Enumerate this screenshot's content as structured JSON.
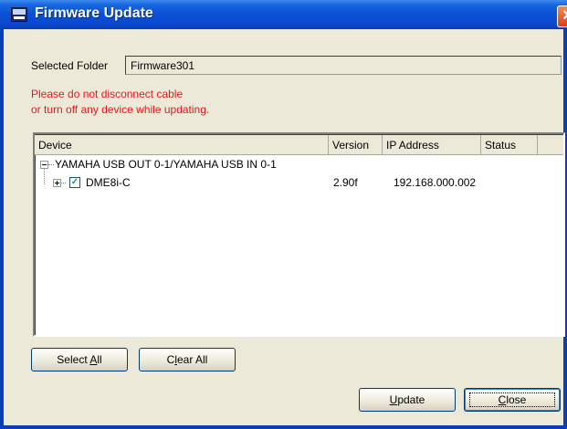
{
  "window": {
    "title": "Firmware Update",
    "close_glyph": "✕",
    "icon": "dme-app-icon"
  },
  "folder": {
    "label": "Selected Folder",
    "value": "Firmware301"
  },
  "warning": {
    "line1": "Please do not disconnect cable",
    "line2": "or turn off any device while updating."
  },
  "table": {
    "columns": [
      "Device",
      "Version",
      "IP Address",
      "Status"
    ],
    "root": {
      "label": "YAMAHA USB OUT 0-1/YAMAHA USB IN 0-1",
      "expanded": true
    },
    "devices": [
      {
        "name": "DME8i-C",
        "version": "2.90f",
        "ip": "192.168.000.002",
        "status": "",
        "checked": true
      }
    ]
  },
  "buttons": {
    "select_all": {
      "pre": "Select ",
      "mnemonic": "A",
      "post": "ll"
    },
    "clear_all": {
      "pre": "C",
      "mnemonic": "l",
      "post": "ear All"
    },
    "update": {
      "pre": "",
      "mnemonic": "U",
      "post": "pdate"
    },
    "close": {
      "pre": "",
      "mnemonic": "C",
      "post": "lose"
    }
  },
  "colors": {
    "titlebar": "#0a4fd6",
    "warning_text": "#e8161a",
    "dialog_bg": "#ece9d8"
  }
}
